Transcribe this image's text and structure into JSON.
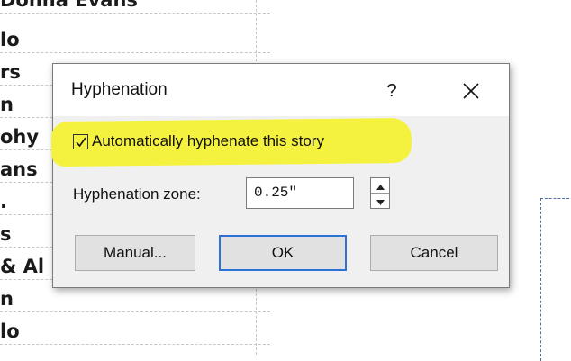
{
  "background": {
    "lines": [
      "Donna Evans",
      "lo",
      "rs",
      "n",
      "ohy",
      "ans",
      ".",
      "s",
      "& Al",
      "n",
      "lo"
    ]
  },
  "dialog": {
    "title": "Hyphenation",
    "help_label": "?",
    "checkbox": {
      "label": "Automatically hyphenate this story",
      "checked": true
    },
    "zone": {
      "label": "Hyphenation zone:",
      "value": "0.25\""
    },
    "buttons": {
      "manual": "Manual...",
      "ok": "OK",
      "cancel": "Cancel"
    }
  },
  "colors": {
    "highlight": "#f5f23f",
    "ok_border": "#2d72d6",
    "dialog_bg": "#f0f0f0"
  }
}
